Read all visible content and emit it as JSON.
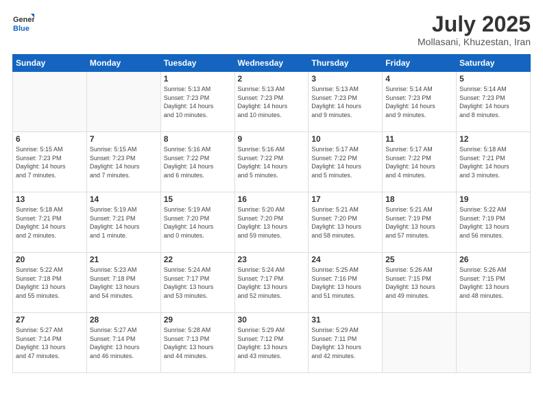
{
  "logo": {
    "general": "General",
    "blue": "Blue"
  },
  "title": "July 2025",
  "subtitle": "Mollasani, Khuzestan, Iran",
  "headers": [
    "Sunday",
    "Monday",
    "Tuesday",
    "Wednesday",
    "Thursday",
    "Friday",
    "Saturday"
  ],
  "weeks": [
    [
      {
        "num": "",
        "info": ""
      },
      {
        "num": "",
        "info": ""
      },
      {
        "num": "1",
        "info": "Sunrise: 5:13 AM\nSunset: 7:23 PM\nDaylight: 14 hours\nand 10 minutes."
      },
      {
        "num": "2",
        "info": "Sunrise: 5:13 AM\nSunset: 7:23 PM\nDaylight: 14 hours\nand 10 minutes."
      },
      {
        "num": "3",
        "info": "Sunrise: 5:13 AM\nSunset: 7:23 PM\nDaylight: 14 hours\nand 9 minutes."
      },
      {
        "num": "4",
        "info": "Sunrise: 5:14 AM\nSunset: 7:23 PM\nDaylight: 14 hours\nand 9 minutes."
      },
      {
        "num": "5",
        "info": "Sunrise: 5:14 AM\nSunset: 7:23 PM\nDaylight: 14 hours\nand 8 minutes."
      }
    ],
    [
      {
        "num": "6",
        "info": "Sunrise: 5:15 AM\nSunset: 7:23 PM\nDaylight: 14 hours\nand 7 minutes."
      },
      {
        "num": "7",
        "info": "Sunrise: 5:15 AM\nSunset: 7:23 PM\nDaylight: 14 hours\nand 7 minutes."
      },
      {
        "num": "8",
        "info": "Sunrise: 5:16 AM\nSunset: 7:22 PM\nDaylight: 14 hours\nand 6 minutes."
      },
      {
        "num": "9",
        "info": "Sunrise: 5:16 AM\nSunset: 7:22 PM\nDaylight: 14 hours\nand 5 minutes."
      },
      {
        "num": "10",
        "info": "Sunrise: 5:17 AM\nSunset: 7:22 PM\nDaylight: 14 hours\nand 5 minutes."
      },
      {
        "num": "11",
        "info": "Sunrise: 5:17 AM\nSunset: 7:22 PM\nDaylight: 14 hours\nand 4 minutes."
      },
      {
        "num": "12",
        "info": "Sunrise: 5:18 AM\nSunset: 7:21 PM\nDaylight: 14 hours\nand 3 minutes."
      }
    ],
    [
      {
        "num": "13",
        "info": "Sunrise: 5:18 AM\nSunset: 7:21 PM\nDaylight: 14 hours\nand 2 minutes."
      },
      {
        "num": "14",
        "info": "Sunrise: 5:19 AM\nSunset: 7:21 PM\nDaylight: 14 hours\nand 1 minute."
      },
      {
        "num": "15",
        "info": "Sunrise: 5:19 AM\nSunset: 7:20 PM\nDaylight: 14 hours\nand 0 minutes."
      },
      {
        "num": "16",
        "info": "Sunrise: 5:20 AM\nSunset: 7:20 PM\nDaylight: 13 hours\nand 59 minutes."
      },
      {
        "num": "17",
        "info": "Sunrise: 5:21 AM\nSunset: 7:20 PM\nDaylight: 13 hours\nand 58 minutes."
      },
      {
        "num": "18",
        "info": "Sunrise: 5:21 AM\nSunset: 7:19 PM\nDaylight: 13 hours\nand 57 minutes."
      },
      {
        "num": "19",
        "info": "Sunrise: 5:22 AM\nSunset: 7:19 PM\nDaylight: 13 hours\nand 56 minutes."
      }
    ],
    [
      {
        "num": "20",
        "info": "Sunrise: 5:22 AM\nSunset: 7:18 PM\nDaylight: 13 hours\nand 55 minutes."
      },
      {
        "num": "21",
        "info": "Sunrise: 5:23 AM\nSunset: 7:18 PM\nDaylight: 13 hours\nand 54 minutes."
      },
      {
        "num": "22",
        "info": "Sunrise: 5:24 AM\nSunset: 7:17 PM\nDaylight: 13 hours\nand 53 minutes."
      },
      {
        "num": "23",
        "info": "Sunrise: 5:24 AM\nSunset: 7:17 PM\nDaylight: 13 hours\nand 52 minutes."
      },
      {
        "num": "24",
        "info": "Sunrise: 5:25 AM\nSunset: 7:16 PM\nDaylight: 13 hours\nand 51 minutes."
      },
      {
        "num": "25",
        "info": "Sunrise: 5:26 AM\nSunset: 7:15 PM\nDaylight: 13 hours\nand 49 minutes."
      },
      {
        "num": "26",
        "info": "Sunrise: 5:26 AM\nSunset: 7:15 PM\nDaylight: 13 hours\nand 48 minutes."
      }
    ],
    [
      {
        "num": "27",
        "info": "Sunrise: 5:27 AM\nSunset: 7:14 PM\nDaylight: 13 hours\nand 47 minutes."
      },
      {
        "num": "28",
        "info": "Sunrise: 5:27 AM\nSunset: 7:14 PM\nDaylight: 13 hours\nand 46 minutes."
      },
      {
        "num": "29",
        "info": "Sunrise: 5:28 AM\nSunset: 7:13 PM\nDaylight: 13 hours\nand 44 minutes."
      },
      {
        "num": "30",
        "info": "Sunrise: 5:29 AM\nSunset: 7:12 PM\nDaylight: 13 hours\nand 43 minutes."
      },
      {
        "num": "31",
        "info": "Sunrise: 5:29 AM\nSunset: 7:11 PM\nDaylight: 13 hours\nand 42 minutes."
      },
      {
        "num": "",
        "info": ""
      },
      {
        "num": "",
        "info": ""
      }
    ]
  ]
}
